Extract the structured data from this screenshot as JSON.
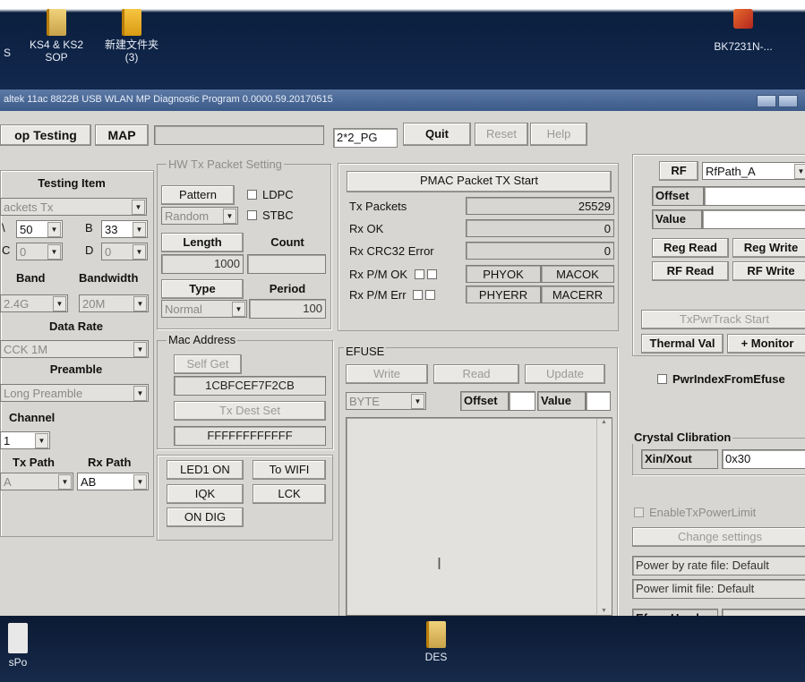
{
  "desktop": {
    "top_icons": [
      {
        "label": "S",
        "label2": ""
      },
      {
        "label": "KS4 & KS2",
        "label2": "SOP"
      },
      {
        "label": "新建文件夹",
        "label2": "(3)"
      },
      {
        "label": "BK7231N-...",
        "label2": ""
      }
    ],
    "bottom_icons": [
      {
        "label": "sPo"
      },
      {
        "label": "DES"
      }
    ]
  },
  "window": {
    "title": "altek 11ac 8822B USB WLAN MP Diagnostic Program 0.0000.59.20170515"
  },
  "tabs": {
    "loop_testing": "op Testing",
    "map": "MAP"
  },
  "toolbar": {
    "mode_field": "2*2_PG",
    "quit": "Quit",
    "reset": "Reset",
    "help": "Help"
  },
  "left_panel": {
    "testing_item_label": "Testing Item",
    "testing_item_value": "ackets Tx",
    "ch_a_label": "\\",
    "ch_a_value": "50",
    "ch_b_label": "B",
    "ch_b_value": "33",
    "ch_c_label": "C",
    "ch_c_value": "0",
    "ch_d_label": "D",
    "ch_d_value": "0",
    "band_label": "Band",
    "bandwidth_label": "Bandwidth",
    "band_value": "2.4G",
    "bandwidth_value": "20M",
    "data_rate_label": "Data Rate",
    "data_rate_value": "CCK 1M",
    "preamble_label": "Preamble",
    "preamble_value": "Long Preamble",
    "channel_label": "Channel",
    "channel_value": "1",
    "tx_path_label": "Tx Path",
    "rx_path_label": "Rx Path",
    "tx_path_value": "A",
    "rx_path_value": "AB"
  },
  "hw_tx": {
    "group_title": "HW Tx Packet Setting",
    "pattern_label": "Pattern",
    "ldpc_label": "LDPC",
    "pattern_value": "Random",
    "stbc_label": "STBC",
    "length_label": "Length",
    "count_label": "Count",
    "length_value": "1000",
    "count_value": "",
    "type_label": "Type",
    "period_label": "Period",
    "type_value": "Normal",
    "period_value": "100"
  },
  "mac": {
    "group_title": "Mac Address",
    "self_get": "Self Get",
    "self_address": "1CBFCEF7F2CB",
    "tx_dest_set": "Tx Dest Set",
    "dest_address": "FFFFFFFFFFFF"
  },
  "misc_buttons": {
    "led1_on": "LED1 ON",
    "to_wifi": "To WIFI",
    "iqk": "IQK",
    "lck": "LCK",
    "on_dig": "ON DIG"
  },
  "pmac": {
    "start_button": "PMAC Packet TX Start",
    "tx_packets_label": "Tx Packets",
    "tx_packets_value": "25529",
    "rx_ok_label": "Rx OK",
    "rx_ok_value": "0",
    "rx_crc_label": "Rx CRC32 Error",
    "rx_crc_value": "0",
    "rx_pm_ok_label": "Rx P/M OK",
    "phy_ok": "PHYOK",
    "mac_ok": "MACOK",
    "rx_pm_err_label": "Rx P/M Err",
    "phy_err": "PHYERR",
    "mac_err": "MACERR"
  },
  "efuse": {
    "group_title": "EFUSE",
    "write": "Write",
    "read": "Read",
    "update": "Update",
    "mode_value": "BYTE",
    "offset_label": "Offset",
    "value_label": "Value"
  },
  "rf": {
    "rf_label": "RF",
    "rf_path_value": "RfPath_A",
    "offset_label": "Offset",
    "value_label": "Value",
    "reg_read": "Reg Read",
    "reg_write": "Reg Write",
    "rf_read": "RF Read",
    "rf_write": "RF Write",
    "txpwr_track": "TxPwrTrack Start",
    "thermal_val": "Thermal Val",
    "monitor": "+ Monitor",
    "pwr_index_label": "PwrIndexFromEfuse",
    "crystal_title": "Crystal Clibration",
    "xin_xout_label": "Xin/Xout",
    "xin_xout_value": "0x30",
    "enable_txpower_limit": "EnableTxPowerLimit",
    "change_settings": "Change settings",
    "power_by_rate": "Power by rate file: Default",
    "power_limit": "Power limit file: Default",
    "efuse_used_label": "Efuse Used"
  }
}
